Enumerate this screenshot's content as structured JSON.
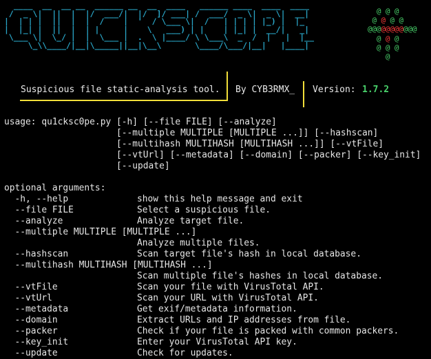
{
  "banner": {
    "ascii_logo": [
      "  ____  __  __ __  ______ __  __  ____   ______ ____  ____  ____",
      " /  _ \\|  ||  |  |/  ___/|  |/  ]/ ___| /  ___/  _ \\|  _ \\|  __|",
      "|  | | |  ||  |  |  /    |  '  / \\___ \\|  /   | | | | |_) |  |_",
      "|  |_| |  ||  |  | |     |    \\   ___) | |    | |_| |  __/|   _|",
      " \\___ \\|  \\_/ |  |  \\___ |  .  \\ |____/ \\ \\___\\  _  /  |   |  |__",
      "     \\_\\\\____/|__|\\_____||__|\\__\\       \\____/\\___/|__|   |____|"
    ],
    "tagline": "Suspicious file static-analysis tool.",
    "author": "By CYB3RMX_",
    "version_label": "Version:",
    "version_value": "1.7.2",
    "colors": {
      "logo": "#2aa7c9",
      "line": "#f2df3a",
      "version": "#49d26b",
      "skull_green": "#49d26b",
      "skull_red": "#ff3b3b"
    }
  },
  "skull_art": [
    [
      {
        "t": "  @ @ @",
        "c": "g"
      }
    ],
    [
      {
        "t": " @ ",
        "c": "g"
      },
      {
        "t": "@",
        "c": "r"
      },
      {
        "t": " @ @",
        "c": "g"
      }
    ],
    [
      {
        "t": "@@@",
        "c": "g"
      },
      {
        "t": "@@@@@",
        "c": "r"
      },
      {
        "t": "@@@",
        "c": "g"
      }
    ],
    [
      {
        "t": "  @ ",
        "c": "g"
      },
      {
        "t": "@",
        "c": "r"
      },
      {
        "t": " @",
        "c": "g"
      }
    ],
    [
      {
        "t": "  @ @ @",
        "c": "g"
      }
    ],
    [
      {
        "t": "    @",
        "c": "g"
      }
    ]
  ],
  "usage_lines": [
    "usage: qu1cksc0pe.py [-h] [--file FILE] [--analyze]",
    "                     [--multiple MULTIPLE [MULTIPLE ...]] [--hashscan]",
    "                     [--multihash MULTIHASH [MULTIHASH ...]] [--vtFile]",
    "                     [--vtUrl] [--metadata] [--domain] [--packer] [--key_init]",
    "                     [--update]"
  ],
  "optional_header": "optional arguments:",
  "arguments": [
    {
      "flag": "  -h, --help",
      "desc": "show this help message and exit"
    },
    {
      "flag": "  --file FILE",
      "desc": "Select a suspicious file."
    },
    {
      "flag": "  --analyze",
      "desc": "Analyze target file."
    },
    {
      "flag": "  --multiple MULTIPLE [MULTIPLE ...]",
      "desc": ""
    },
    {
      "flag": "",
      "desc": "Analyze multiple files."
    },
    {
      "flag": "  --hashscan",
      "desc": "Scan target file's hash in local database."
    },
    {
      "flag": "  --multihash MULTIHASH [MULTIHASH ...]",
      "desc": ""
    },
    {
      "flag": "",
      "desc": "Scan multiple file's hashes in local database."
    },
    {
      "flag": "  --vtFile",
      "desc": "Scan your file with VirusTotal API."
    },
    {
      "flag": "  --vtUrl",
      "desc": "Scan your URL with VirusTotal API."
    },
    {
      "flag": "  --metadata",
      "desc": "Get exif/metadata information."
    },
    {
      "flag": "  --domain",
      "desc": "Extract URLs and IP addresses from file."
    },
    {
      "flag": "  --packer",
      "desc": "Check if your file is packed with common packers."
    },
    {
      "flag": "  --key_init",
      "desc": "Enter your VirusTotal API key."
    },
    {
      "flag": "  --update",
      "desc": "Check for updates."
    }
  ]
}
